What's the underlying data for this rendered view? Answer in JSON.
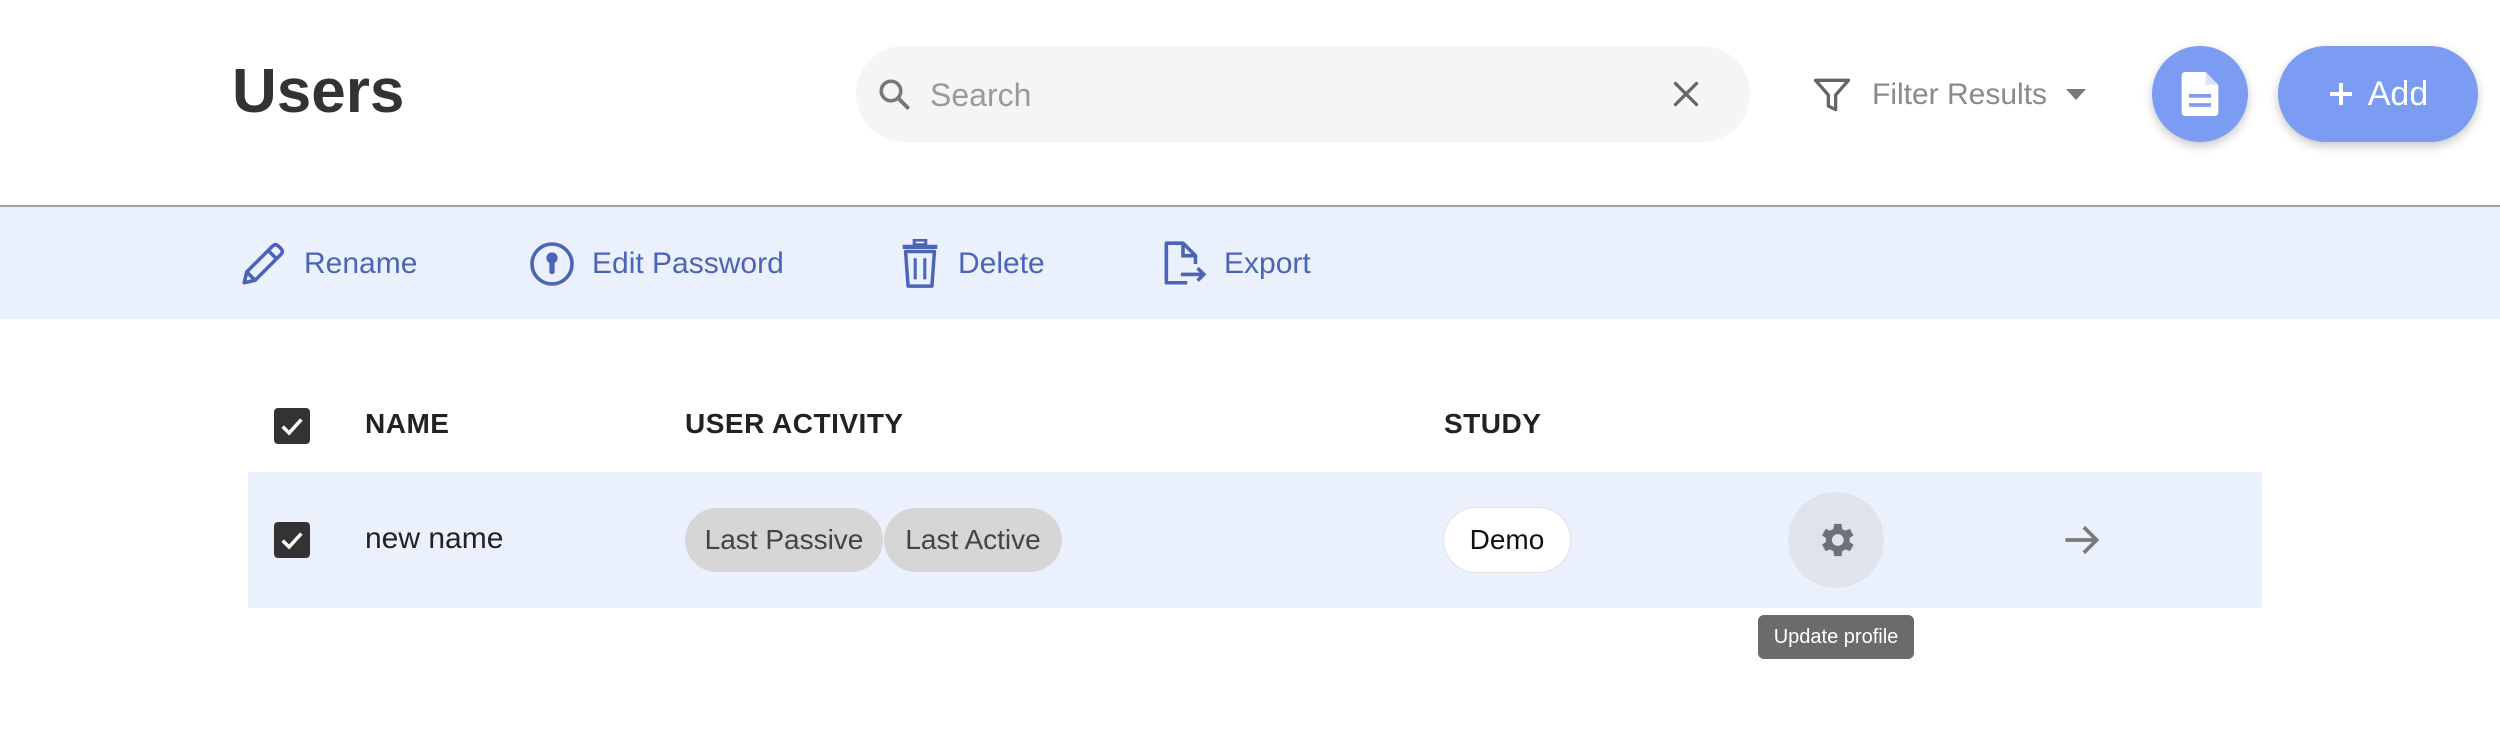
{
  "header": {
    "title": "Users",
    "search": {
      "placeholder": "Search",
      "value": ""
    },
    "filter_label": "Filter Results",
    "add_label": "Add"
  },
  "toolbar": {
    "rename_label": "Rename",
    "edit_password_label": "Edit Password",
    "delete_label": "Delete",
    "export_label": "Export"
  },
  "table": {
    "columns": [
      "NAME",
      "USER ACTIVITY",
      "STUDY"
    ],
    "rows": [
      {
        "name": "new name",
        "activity": [
          "Last Passive",
          "Last Active"
        ],
        "study": "Demo",
        "selected": true
      }
    ],
    "select_all": true
  },
  "tooltip": {
    "text": "Update profile"
  },
  "colors": {
    "accent": "#7b9cf2",
    "toolbar_bg": "#eaf1fc",
    "toolbar_text": "#4b64b5",
    "chip_bg": "#d6d6d6"
  },
  "icons": {
    "search": "search-icon",
    "clear": "close-icon",
    "filter": "filter-icon",
    "doc": "document-icon",
    "add": "plus-icon",
    "rename": "pencil-icon",
    "password": "keyhole-icon",
    "delete": "trash-icon",
    "export": "export-icon",
    "settings": "gear-icon",
    "open": "arrow-right-icon"
  }
}
